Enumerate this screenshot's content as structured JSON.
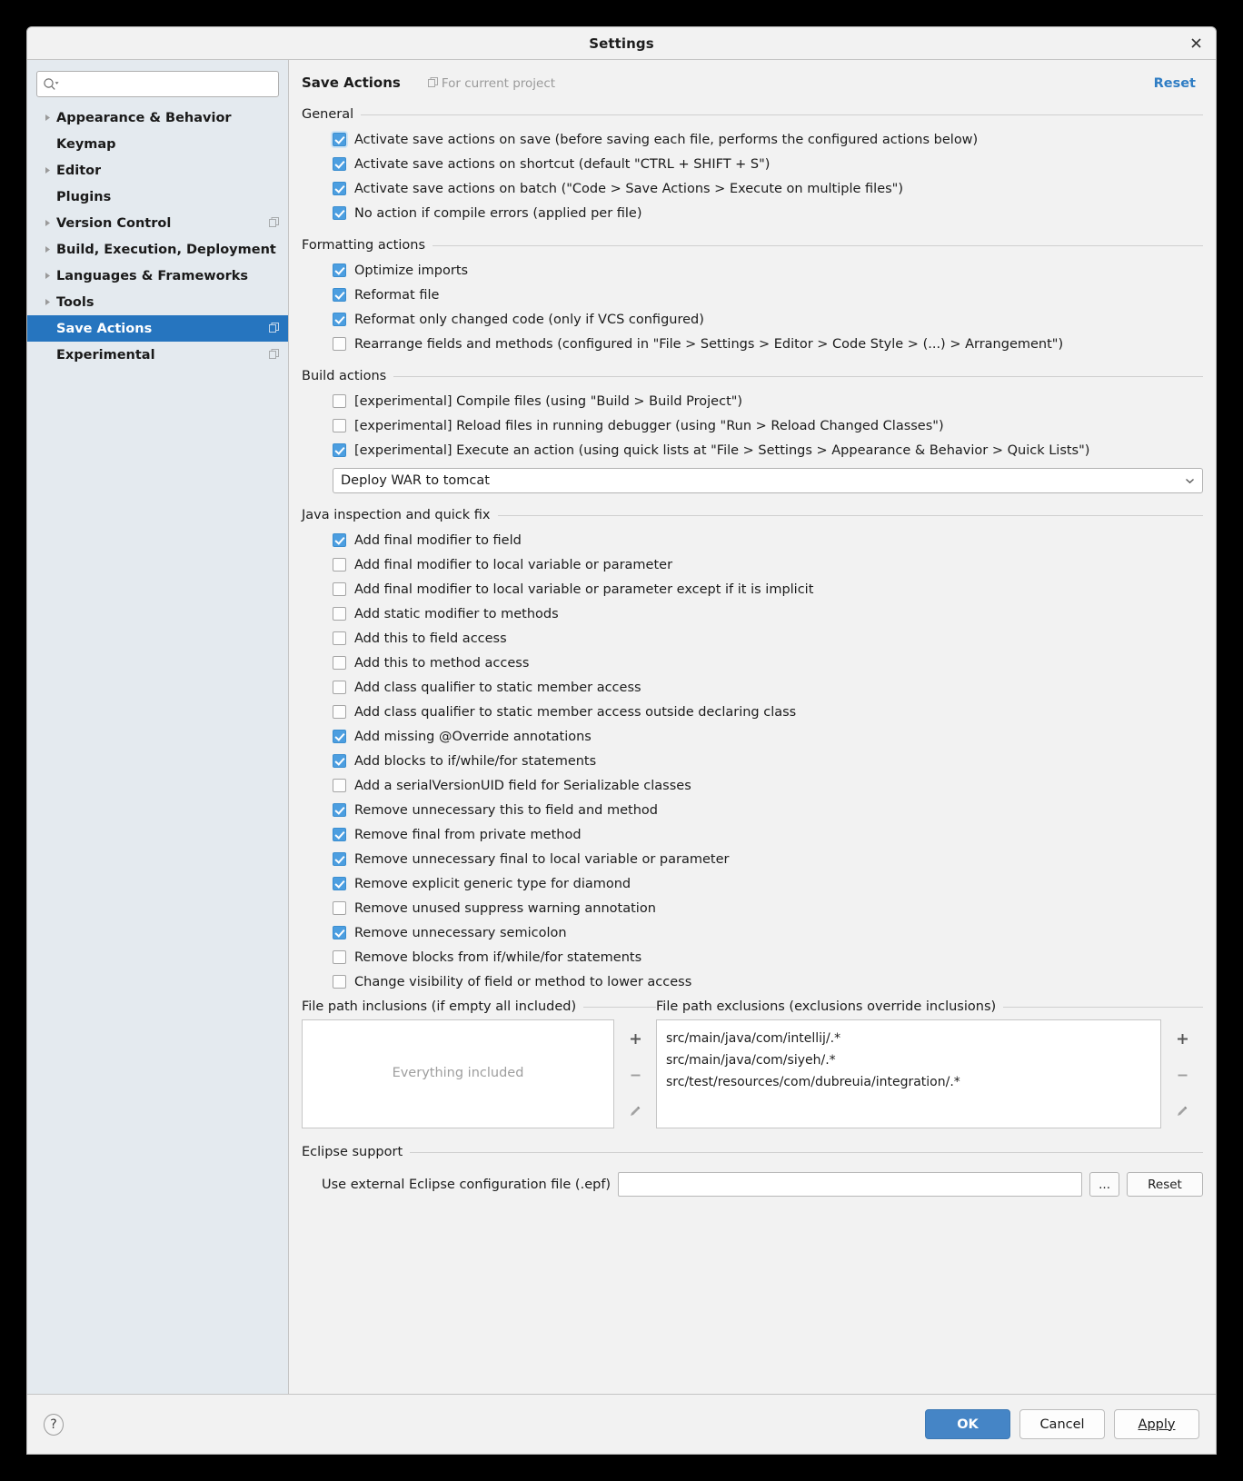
{
  "window": {
    "title": "Settings",
    "close_icon": "close-icon"
  },
  "sidebar": {
    "search": {
      "placeholder": "",
      "value": "",
      "icon": "search-icon"
    },
    "items": [
      {
        "label": "Appearance & Behavior",
        "expandable": true,
        "selected": false,
        "project_icon": false
      },
      {
        "label": "Keymap",
        "expandable": false,
        "selected": false,
        "project_icon": false
      },
      {
        "label": "Editor",
        "expandable": true,
        "selected": false,
        "project_icon": false
      },
      {
        "label": "Plugins",
        "expandable": false,
        "selected": false,
        "project_icon": false
      },
      {
        "label": "Version Control",
        "expandable": true,
        "selected": false,
        "project_icon": true
      },
      {
        "label": "Build, Execution, Deployment",
        "expandable": true,
        "selected": false,
        "project_icon": false
      },
      {
        "label": "Languages & Frameworks",
        "expandable": true,
        "selected": false,
        "project_icon": false
      },
      {
        "label": "Tools",
        "expandable": true,
        "selected": false,
        "project_icon": false
      },
      {
        "label": "Save Actions",
        "expandable": false,
        "selected": true,
        "project_icon": true
      },
      {
        "label": "Experimental",
        "expandable": false,
        "selected": false,
        "project_icon": true
      }
    ]
  },
  "header": {
    "title": "Save Actions",
    "for_project": "For current project",
    "reset_label": "Reset"
  },
  "groups": {
    "general": {
      "title": "General",
      "items": [
        {
          "label": "Activate save actions on save (before saving each file, performs the configured actions below)",
          "checked": true,
          "focused": true
        },
        {
          "label": "Activate save actions on shortcut (default \"CTRL + SHIFT + S\")",
          "checked": true,
          "focused": false
        },
        {
          "label": "Activate save actions on batch (\"Code > Save Actions > Execute on multiple files\")",
          "checked": true,
          "focused": false
        },
        {
          "label": "No action if compile errors (applied per file)",
          "checked": true,
          "focused": false
        }
      ]
    },
    "formatting": {
      "title": "Formatting actions",
      "items": [
        {
          "label": "Optimize imports",
          "checked": true
        },
        {
          "label": "Reformat file",
          "checked": true
        },
        {
          "label": "Reformat only changed code (only if VCS configured)",
          "checked": true
        },
        {
          "label": "Rearrange fields and methods (configured in \"File > Settings > Editor > Code Style > (...) > Arrangement\")",
          "checked": false
        }
      ]
    },
    "build": {
      "title": "Build actions",
      "items": [
        {
          "label": "[experimental] Compile files (using \"Build > Build Project\")",
          "checked": false
        },
        {
          "label": "[experimental] Reload files in running debugger (using \"Run > Reload Changed Classes\")",
          "checked": false
        },
        {
          "label": "[experimental] Execute an action (using quick lists at \"File > Settings > Appearance & Behavior > Quick Lists\")",
          "checked": true
        }
      ],
      "quick_list_combo": {
        "value": "Deploy WAR to tomcat",
        "icon": "chevron-down-icon"
      }
    },
    "java": {
      "title": "Java inspection and quick fix",
      "items": [
        {
          "label": "Add final modifier to field",
          "checked": true
        },
        {
          "label": "Add final modifier to local variable or parameter",
          "checked": false
        },
        {
          "label": "Add final modifier to local variable or parameter except if it is implicit",
          "checked": false
        },
        {
          "label": "Add static modifier to methods",
          "checked": false
        },
        {
          "label": "Add this to field access",
          "checked": false
        },
        {
          "label": "Add this to method access",
          "checked": false
        },
        {
          "label": "Add class qualifier to static member access",
          "checked": false
        },
        {
          "label": "Add class qualifier to static member access outside declaring class",
          "checked": false
        },
        {
          "label": "Add missing @Override annotations",
          "checked": true
        },
        {
          "label": "Add blocks to if/while/for statements",
          "checked": true
        },
        {
          "label": "Add a serialVersionUID field for Serializable classes",
          "checked": false
        },
        {
          "label": "Remove unnecessary this to field and method",
          "checked": true
        },
        {
          "label": "Remove final from private method",
          "checked": true
        },
        {
          "label": "Remove unnecessary final to local variable or parameter",
          "checked": true
        },
        {
          "label": "Remove explicit generic type for diamond",
          "checked": true
        },
        {
          "label": "Remove unused suppress warning annotation",
          "checked": false
        },
        {
          "label": "Remove unnecessary semicolon",
          "checked": true
        },
        {
          "label": "Remove blocks from if/while/for statements",
          "checked": false
        },
        {
          "label": "Change visibility of field or method to lower access",
          "checked": false
        }
      ]
    }
  },
  "paths": {
    "inclusions": {
      "title": "File path inclusions (if empty all included)",
      "empty_text": "Everything included",
      "entries": []
    },
    "exclusions": {
      "title": "File path exclusions (exclusions override inclusions)",
      "entries": [
        "src/main/java/com/intellij/.*",
        "src/main/java/com/siyeh/.*",
        "src/test/resources/com/dubreuia/integration/.*"
      ]
    },
    "tools": [
      {
        "name": "add-path-button",
        "glyph": "+"
      },
      {
        "name": "remove-path-button",
        "glyph": "−"
      },
      {
        "name": "edit-path-button",
        "glyph": "pencil-icon"
      }
    ]
  },
  "eclipse": {
    "title": "Eclipse support",
    "field_label": "Use external Eclipse configuration file (.epf)",
    "field_value": "",
    "browse_label": "...",
    "reset_label": "Reset"
  },
  "footer": {
    "help_label": "?",
    "ok_label": "OK",
    "cancel_label": "Cancel",
    "apply_label": "Apply"
  },
  "colors": {
    "accent": "#2675bf",
    "link": "#2f7dc4",
    "checkbox": "#4c9ee0",
    "sidebar_bg": "#e4eaef",
    "primary_button": "#4585c6"
  }
}
